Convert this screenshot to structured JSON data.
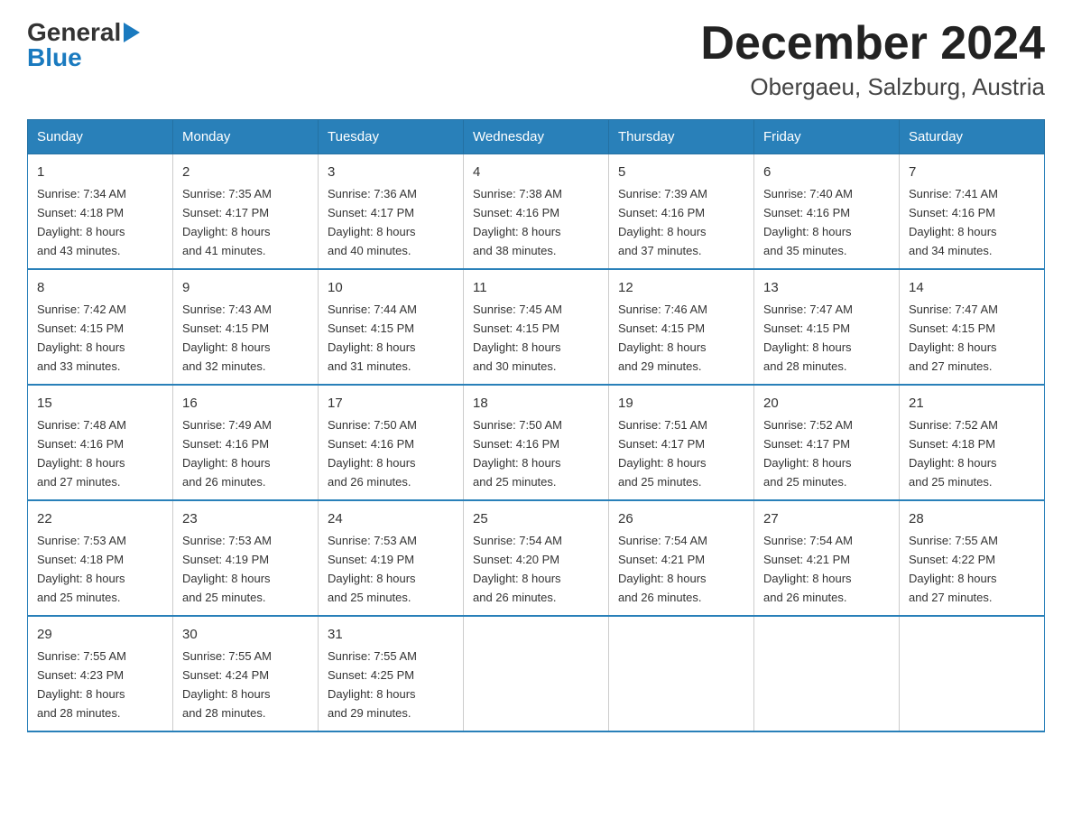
{
  "header": {
    "title": "December 2024",
    "subtitle": "Obergaeu, Salzburg, Austria",
    "logo": {
      "general": "General",
      "blue": "Blue"
    }
  },
  "columns": [
    "Sunday",
    "Monday",
    "Tuesday",
    "Wednesday",
    "Thursday",
    "Friday",
    "Saturday"
  ],
  "weeks": [
    [
      {
        "day": "1",
        "sunrise": "7:34 AM",
        "sunset": "4:18 PM",
        "daylight": "8 hours and 43 minutes."
      },
      {
        "day": "2",
        "sunrise": "7:35 AM",
        "sunset": "4:17 PM",
        "daylight": "8 hours and 41 minutes."
      },
      {
        "day": "3",
        "sunrise": "7:36 AM",
        "sunset": "4:17 PM",
        "daylight": "8 hours and 40 minutes."
      },
      {
        "day": "4",
        "sunrise": "7:38 AM",
        "sunset": "4:16 PM",
        "daylight": "8 hours and 38 minutes."
      },
      {
        "day": "5",
        "sunrise": "7:39 AM",
        "sunset": "4:16 PM",
        "daylight": "8 hours and 37 minutes."
      },
      {
        "day": "6",
        "sunrise": "7:40 AM",
        "sunset": "4:16 PM",
        "daylight": "8 hours and 35 minutes."
      },
      {
        "day": "7",
        "sunrise": "7:41 AM",
        "sunset": "4:16 PM",
        "daylight": "8 hours and 34 minutes."
      }
    ],
    [
      {
        "day": "8",
        "sunrise": "7:42 AM",
        "sunset": "4:15 PM",
        "daylight": "8 hours and 33 minutes."
      },
      {
        "day": "9",
        "sunrise": "7:43 AM",
        "sunset": "4:15 PM",
        "daylight": "8 hours and 32 minutes."
      },
      {
        "day": "10",
        "sunrise": "7:44 AM",
        "sunset": "4:15 PM",
        "daylight": "8 hours and 31 minutes."
      },
      {
        "day": "11",
        "sunrise": "7:45 AM",
        "sunset": "4:15 PM",
        "daylight": "8 hours and 30 minutes."
      },
      {
        "day": "12",
        "sunrise": "7:46 AM",
        "sunset": "4:15 PM",
        "daylight": "8 hours and 29 minutes."
      },
      {
        "day": "13",
        "sunrise": "7:47 AM",
        "sunset": "4:15 PM",
        "daylight": "8 hours and 28 minutes."
      },
      {
        "day": "14",
        "sunrise": "7:47 AM",
        "sunset": "4:15 PM",
        "daylight": "8 hours and 27 minutes."
      }
    ],
    [
      {
        "day": "15",
        "sunrise": "7:48 AM",
        "sunset": "4:16 PM",
        "daylight": "8 hours and 27 minutes."
      },
      {
        "day": "16",
        "sunrise": "7:49 AM",
        "sunset": "4:16 PM",
        "daylight": "8 hours and 26 minutes."
      },
      {
        "day": "17",
        "sunrise": "7:50 AM",
        "sunset": "4:16 PM",
        "daylight": "8 hours and 26 minutes."
      },
      {
        "day": "18",
        "sunrise": "7:50 AM",
        "sunset": "4:16 PM",
        "daylight": "8 hours and 25 minutes."
      },
      {
        "day": "19",
        "sunrise": "7:51 AM",
        "sunset": "4:17 PM",
        "daylight": "8 hours and 25 minutes."
      },
      {
        "day": "20",
        "sunrise": "7:52 AM",
        "sunset": "4:17 PM",
        "daylight": "8 hours and 25 minutes."
      },
      {
        "day": "21",
        "sunrise": "7:52 AM",
        "sunset": "4:18 PM",
        "daylight": "8 hours and 25 minutes."
      }
    ],
    [
      {
        "day": "22",
        "sunrise": "7:53 AM",
        "sunset": "4:18 PM",
        "daylight": "8 hours and 25 minutes."
      },
      {
        "day": "23",
        "sunrise": "7:53 AM",
        "sunset": "4:19 PM",
        "daylight": "8 hours and 25 minutes."
      },
      {
        "day": "24",
        "sunrise": "7:53 AM",
        "sunset": "4:19 PM",
        "daylight": "8 hours and 25 minutes."
      },
      {
        "day": "25",
        "sunrise": "7:54 AM",
        "sunset": "4:20 PM",
        "daylight": "8 hours and 26 minutes."
      },
      {
        "day": "26",
        "sunrise": "7:54 AM",
        "sunset": "4:21 PM",
        "daylight": "8 hours and 26 minutes."
      },
      {
        "day": "27",
        "sunrise": "7:54 AM",
        "sunset": "4:21 PM",
        "daylight": "8 hours and 26 minutes."
      },
      {
        "day": "28",
        "sunrise": "7:55 AM",
        "sunset": "4:22 PM",
        "daylight": "8 hours and 27 minutes."
      }
    ],
    [
      {
        "day": "29",
        "sunrise": "7:55 AM",
        "sunset": "4:23 PM",
        "daylight": "8 hours and 28 minutes."
      },
      {
        "day": "30",
        "sunrise": "7:55 AM",
        "sunset": "4:24 PM",
        "daylight": "8 hours and 28 minutes."
      },
      {
        "day": "31",
        "sunrise": "7:55 AM",
        "sunset": "4:25 PM",
        "daylight": "8 hours and 29 minutes."
      },
      null,
      null,
      null,
      null
    ]
  ],
  "labels": {
    "sunrise": "Sunrise:",
    "sunset": "Sunset:",
    "daylight": "Daylight:"
  }
}
